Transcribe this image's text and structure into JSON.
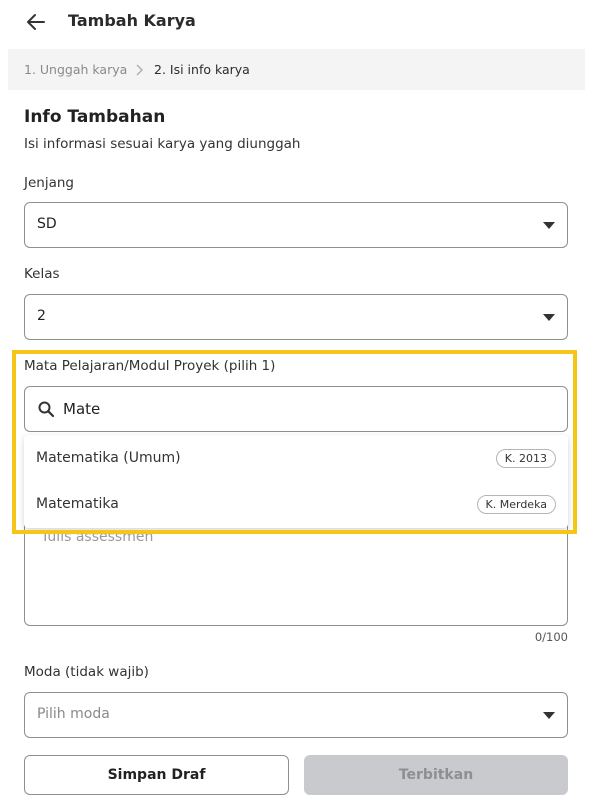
{
  "header": {
    "title": "Tambah Karya",
    "back_icon": "arrow-left-icon"
  },
  "stepper": {
    "step1": "1. Unggah karya",
    "step2": "2. Isi info karya",
    "separator_icon": "chevron-right-icon"
  },
  "info": {
    "title": "Info Tambahan",
    "subtitle": "Isi informasi sesuai karya yang diunggah"
  },
  "jenjang": {
    "label": "Jenjang",
    "value": "SD"
  },
  "kelas": {
    "label": "Kelas",
    "value": "2"
  },
  "subject": {
    "label": "Mata Pelajaran/Modul Proyek (pilih 1)",
    "search_value": "Mate",
    "options": [
      {
        "label": "Matematika (Umum)",
        "badge": "K. 2013"
      },
      {
        "label": "Matematika",
        "badge": "K. Merdeka"
      }
    ]
  },
  "assessment": {
    "placeholder": "Tulis assessmen",
    "counter": "0/100"
  },
  "moda": {
    "label": "Moda (tidak wajib)",
    "placeholder": "Pilih moda"
  },
  "actions": {
    "draft_label": "Simpan Draf",
    "publish_label": "Terbitkan"
  },
  "colors": {
    "highlight": "#f5c518",
    "disabled_button": "#c9cacd"
  }
}
